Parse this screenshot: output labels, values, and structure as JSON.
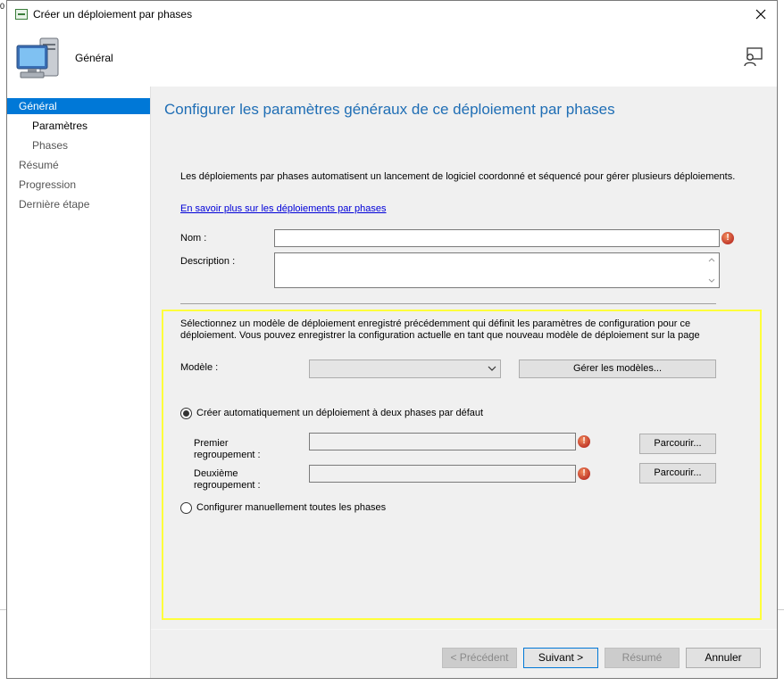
{
  "window": {
    "title": "Créer un déploiement par phases",
    "close_glyph": "✕"
  },
  "edge": {
    "mark": "0"
  },
  "header": {
    "title": "Général"
  },
  "sidebar": {
    "items": [
      {
        "label": "Général"
      },
      {
        "label": "Paramètres"
      },
      {
        "label": "Phases"
      },
      {
        "label": "Résumé"
      },
      {
        "label": "Progression"
      },
      {
        "label": "Dernière étape"
      }
    ]
  },
  "main": {
    "page_title": "Configurer les paramètres généraux de ce déploiement par phases",
    "description": "Les déploiements par phases automatisent un lancement de logiciel coordonné et séquencé pour gérer plusieurs déploiements.",
    "learn_more": "En savoir plus sur les déploiements par phases",
    "name_label": "Nom :",
    "name_value": "",
    "description_label": "Description :",
    "description_value": "",
    "template_text": "Sélectionnez un modèle de déploiement enregistré précédemment qui définit les paramètres de configuration pour ce déploiement. Vous pouvez enregistrer la configuration actuelle en tant que nouveau modèle de déploiement sur la page",
    "template_label": "Modèle :",
    "template_value": "",
    "manage_templates_button": "Gérer les modèles...",
    "radio_auto_label": "Créer automatiquement un déploiement à deux phases par défaut",
    "radio_manual_label": "Configurer manuellement toutes les phases",
    "first_collection_label_line1": "Premier",
    "first_collection_label_line2": "regroupement :",
    "first_collection_value": "",
    "second_collection_label_line1": "Deuxième",
    "second_collection_label_line2": "regroupement :",
    "second_collection_value": "",
    "browse_button": "Parcourir...",
    "error_glyph": "!"
  },
  "footer": {
    "previous": "< Précédent",
    "next": "Suivant >",
    "summary": "Résumé",
    "cancel": "Annuler"
  },
  "colors": {
    "accent": "#0078d7",
    "title_blue": "#1f6eb5",
    "highlight": "#ffff3b",
    "error": "#c0392b"
  }
}
